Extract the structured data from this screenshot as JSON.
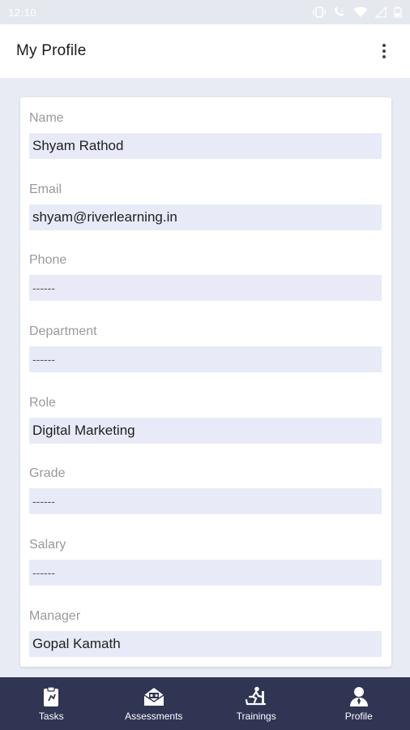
{
  "status_bar": {
    "time": "12:10"
  },
  "app_bar": {
    "title": "My Profile",
    "menu_icon": "more-vert-icon"
  },
  "profile": {
    "fields": [
      {
        "label": "Name",
        "value": "Shyam Rathod"
      },
      {
        "label": "Email",
        "value": "shyam@riverlearning.in"
      },
      {
        "label": "Phone",
        "value": "------"
      },
      {
        "label": "Department",
        "value": "------"
      },
      {
        "label": "Role",
        "value": "Digital Marketing"
      },
      {
        "label": "Grade",
        "value": "------"
      },
      {
        "label": "Salary",
        "value": "------"
      },
      {
        "label": "Manager",
        "value": "Gopal Kamath"
      }
    ]
  },
  "bottom_nav": {
    "items": [
      {
        "label": "Tasks",
        "icon": "clipboard-icon"
      },
      {
        "label": "Assessments",
        "icon": "assessment-icon"
      },
      {
        "label": "Trainings",
        "icon": "treadmill-icon"
      },
      {
        "label": "Profile",
        "icon": "person-icon"
      }
    ]
  },
  "colors": {
    "background": "#e8ebf4",
    "card": "#ffffff",
    "field_bg": "#e8ebf7",
    "nav_bg": "#2f3553"
  }
}
